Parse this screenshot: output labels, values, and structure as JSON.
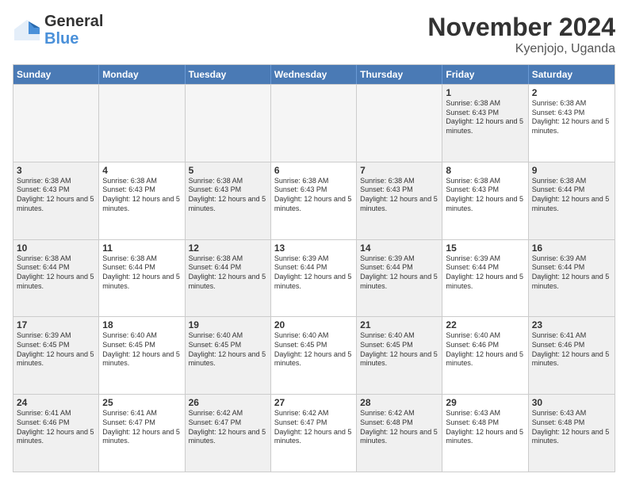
{
  "logo": {
    "line1": "General",
    "line2": "Blue"
  },
  "title": "November 2024",
  "subtitle": "Kyenjojo, Uganda",
  "header_days": [
    "Sunday",
    "Monday",
    "Tuesday",
    "Wednesday",
    "Thursday",
    "Friday",
    "Saturday"
  ],
  "weeks": [
    [
      {
        "day": "",
        "info": "",
        "empty": true
      },
      {
        "day": "",
        "info": "",
        "empty": true
      },
      {
        "day": "",
        "info": "",
        "empty": true
      },
      {
        "day": "",
        "info": "",
        "empty": true
      },
      {
        "day": "",
        "info": "",
        "empty": true
      },
      {
        "day": "1",
        "info": "Sunrise: 6:38 AM\nSunset: 6:43 PM\nDaylight: 12 hours and 5 minutes.",
        "empty": false,
        "shaded": true
      },
      {
        "day": "2",
        "info": "Sunrise: 6:38 AM\nSunset: 6:43 PM\nDaylight: 12 hours and 5 minutes.",
        "empty": false,
        "shaded": false
      }
    ],
    [
      {
        "day": "3",
        "info": "Sunrise: 6:38 AM\nSunset: 6:43 PM\nDaylight: 12 hours and 5 minutes.",
        "empty": false,
        "shaded": true
      },
      {
        "day": "4",
        "info": "Sunrise: 6:38 AM\nSunset: 6:43 PM\nDaylight: 12 hours and 5 minutes.",
        "empty": false,
        "shaded": false
      },
      {
        "day": "5",
        "info": "Sunrise: 6:38 AM\nSunset: 6:43 PM\nDaylight: 12 hours and 5 minutes.",
        "empty": false,
        "shaded": true
      },
      {
        "day": "6",
        "info": "Sunrise: 6:38 AM\nSunset: 6:43 PM\nDaylight: 12 hours and 5 minutes.",
        "empty": false,
        "shaded": false
      },
      {
        "day": "7",
        "info": "Sunrise: 6:38 AM\nSunset: 6:43 PM\nDaylight: 12 hours and 5 minutes.",
        "empty": false,
        "shaded": true
      },
      {
        "day": "8",
        "info": "Sunrise: 6:38 AM\nSunset: 6:43 PM\nDaylight: 12 hours and 5 minutes.",
        "empty": false,
        "shaded": false
      },
      {
        "day": "9",
        "info": "Sunrise: 6:38 AM\nSunset: 6:44 PM\nDaylight: 12 hours and 5 minutes.",
        "empty": false,
        "shaded": true
      }
    ],
    [
      {
        "day": "10",
        "info": "Sunrise: 6:38 AM\nSunset: 6:44 PM\nDaylight: 12 hours and 5 minutes.",
        "empty": false,
        "shaded": true
      },
      {
        "day": "11",
        "info": "Sunrise: 6:38 AM\nSunset: 6:44 PM\nDaylight: 12 hours and 5 minutes.",
        "empty": false,
        "shaded": false
      },
      {
        "day": "12",
        "info": "Sunrise: 6:38 AM\nSunset: 6:44 PM\nDaylight: 12 hours and 5 minutes.",
        "empty": false,
        "shaded": true
      },
      {
        "day": "13",
        "info": "Sunrise: 6:39 AM\nSunset: 6:44 PM\nDaylight: 12 hours and 5 minutes.",
        "empty": false,
        "shaded": false
      },
      {
        "day": "14",
        "info": "Sunrise: 6:39 AM\nSunset: 6:44 PM\nDaylight: 12 hours and 5 minutes.",
        "empty": false,
        "shaded": true
      },
      {
        "day": "15",
        "info": "Sunrise: 6:39 AM\nSunset: 6:44 PM\nDaylight: 12 hours and 5 minutes.",
        "empty": false,
        "shaded": false
      },
      {
        "day": "16",
        "info": "Sunrise: 6:39 AM\nSunset: 6:44 PM\nDaylight: 12 hours and 5 minutes.",
        "empty": false,
        "shaded": true
      }
    ],
    [
      {
        "day": "17",
        "info": "Sunrise: 6:39 AM\nSunset: 6:45 PM\nDaylight: 12 hours and 5 minutes.",
        "empty": false,
        "shaded": true
      },
      {
        "day": "18",
        "info": "Sunrise: 6:40 AM\nSunset: 6:45 PM\nDaylight: 12 hours and 5 minutes.",
        "empty": false,
        "shaded": false
      },
      {
        "day": "19",
        "info": "Sunrise: 6:40 AM\nSunset: 6:45 PM\nDaylight: 12 hours and 5 minutes.",
        "empty": false,
        "shaded": true
      },
      {
        "day": "20",
        "info": "Sunrise: 6:40 AM\nSunset: 6:45 PM\nDaylight: 12 hours and 5 minutes.",
        "empty": false,
        "shaded": false
      },
      {
        "day": "21",
        "info": "Sunrise: 6:40 AM\nSunset: 6:45 PM\nDaylight: 12 hours and 5 minutes.",
        "empty": false,
        "shaded": true
      },
      {
        "day": "22",
        "info": "Sunrise: 6:40 AM\nSunset: 6:46 PM\nDaylight: 12 hours and 5 minutes.",
        "empty": false,
        "shaded": false
      },
      {
        "day": "23",
        "info": "Sunrise: 6:41 AM\nSunset: 6:46 PM\nDaylight: 12 hours and 5 minutes.",
        "empty": false,
        "shaded": true
      }
    ],
    [
      {
        "day": "24",
        "info": "Sunrise: 6:41 AM\nSunset: 6:46 PM\nDaylight: 12 hours and 5 minutes.",
        "empty": false,
        "shaded": true
      },
      {
        "day": "25",
        "info": "Sunrise: 6:41 AM\nSunset: 6:47 PM\nDaylight: 12 hours and 5 minutes.",
        "empty": false,
        "shaded": false
      },
      {
        "day": "26",
        "info": "Sunrise: 6:42 AM\nSunset: 6:47 PM\nDaylight: 12 hours and 5 minutes.",
        "empty": false,
        "shaded": true
      },
      {
        "day": "27",
        "info": "Sunrise: 6:42 AM\nSunset: 6:47 PM\nDaylight: 12 hours and 5 minutes.",
        "empty": false,
        "shaded": false
      },
      {
        "day": "28",
        "info": "Sunrise: 6:42 AM\nSunset: 6:48 PM\nDaylight: 12 hours and 5 minutes.",
        "empty": false,
        "shaded": true
      },
      {
        "day": "29",
        "info": "Sunrise: 6:43 AM\nSunset: 6:48 PM\nDaylight: 12 hours and 5 minutes.",
        "empty": false,
        "shaded": false
      },
      {
        "day": "30",
        "info": "Sunrise: 6:43 AM\nSunset: 6:48 PM\nDaylight: 12 hours and 5 minutes.",
        "empty": false,
        "shaded": true
      }
    ]
  ]
}
